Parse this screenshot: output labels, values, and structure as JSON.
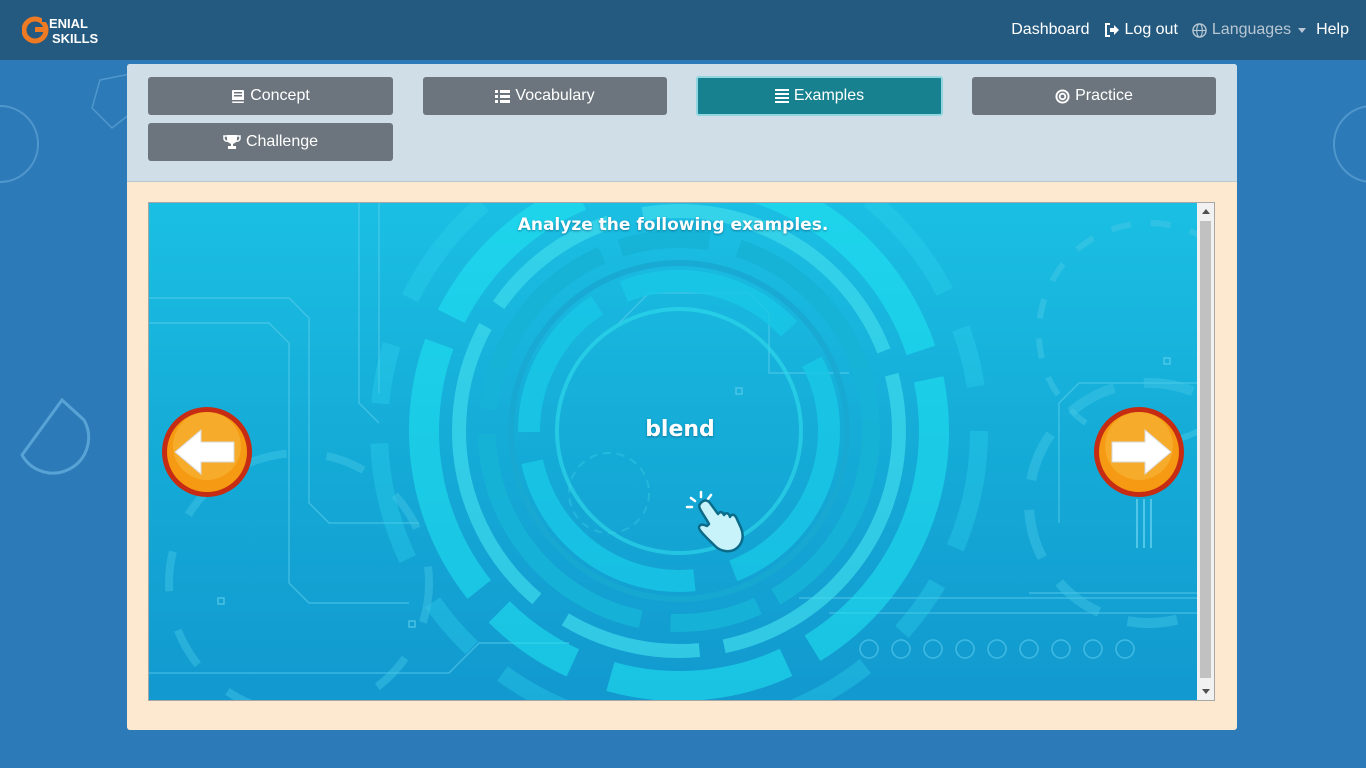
{
  "app": {
    "logo_text_top": "ENIAL",
    "logo_text_bottom": "SKILLS",
    "logo_letter": "G"
  },
  "nav": {
    "dashboard": "Dashboard",
    "logout": "Log out",
    "languages": "Languages",
    "help": "Help"
  },
  "tabs": [
    {
      "label": "Concept",
      "icon": "book-icon",
      "active": false
    },
    {
      "label": "Vocabulary",
      "icon": "list-icon",
      "active": false
    },
    {
      "label": "Examples",
      "icon": "align-justify-icon",
      "active": true
    },
    {
      "label": "Practice",
      "icon": "bullseye-icon",
      "active": false
    },
    {
      "label": "Challenge",
      "icon": "trophy-icon",
      "active": false
    }
  ],
  "activity": {
    "instruction": "Analyze the following examples.",
    "word": "blend",
    "prev_button": "arrow-left-icon",
    "next_button": "arrow-right-icon",
    "hint": "tap-hand-icon"
  },
  "colors": {
    "navbar": "#245a80",
    "page_bg": "#2d7ab8",
    "tab_default": "#6c757d",
    "tab_active": "#17818f",
    "card_bg": "#fde9cf",
    "tabs_panel": "#cfdee7",
    "arrow_orange": "#f08a12"
  }
}
